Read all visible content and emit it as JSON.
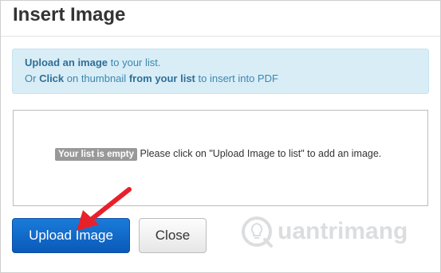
{
  "dialog": {
    "title": "Insert Image"
  },
  "info": {
    "line1_bold": "Upload an image",
    "line1_rest": " to your list.",
    "line2_pre": "Or ",
    "line2_bold1": "Click",
    "line2_mid": " on thumbnail ",
    "line2_bold2": "from your list",
    "line2_rest": " to insert into PDF"
  },
  "list": {
    "empty_badge": "Your list is empty",
    "empty_message": " Please click on \"Upload Image to list\" to add an image."
  },
  "buttons": {
    "upload_label": "Upload Image",
    "close_label": "Close"
  },
  "watermark": {
    "text": "uantrimang"
  },
  "colors": {
    "primary_button": "#0a6ad0",
    "info_background": "#d9edf7",
    "info_text": "#3a87ad",
    "annotation_arrow": "#e8202a"
  }
}
